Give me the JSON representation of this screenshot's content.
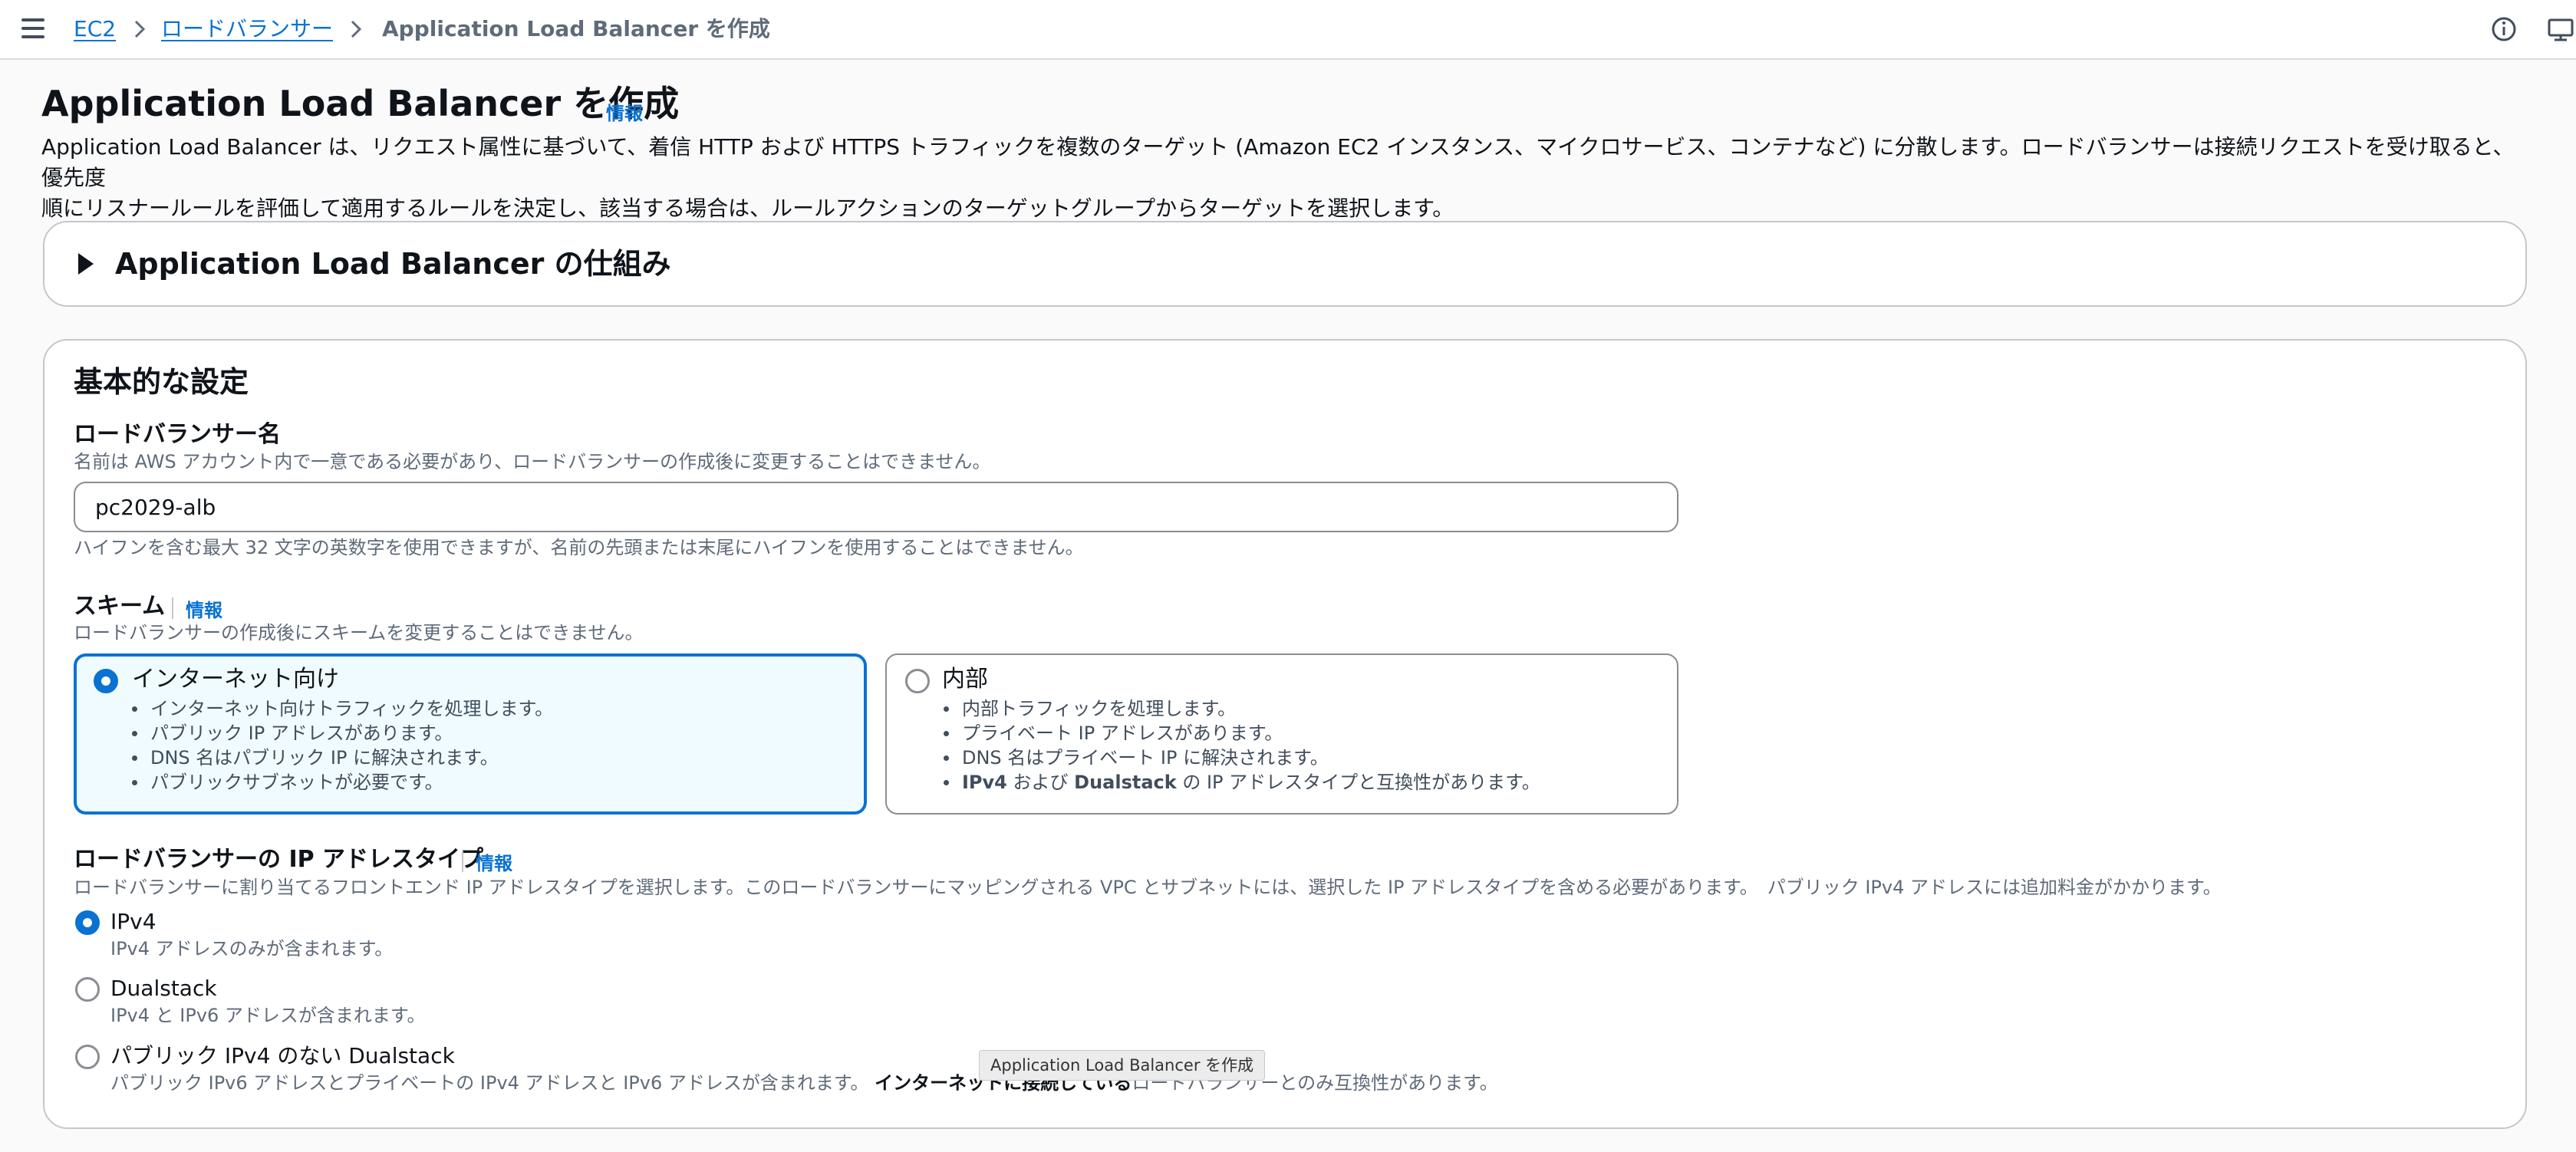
{
  "breadcrumb": {
    "items": [
      "EC2",
      "ロードバランサー"
    ],
    "current": "Application Load Balancer を作成"
  },
  "icons": {
    "menu": "hamburger-menu-icon",
    "separator": "chevron-right-icon",
    "info": "info-circle-icon",
    "feedback": "screen-feedback-icon",
    "expand": "caret-right-icon"
  },
  "header": {
    "title": "Application Load Balancer を作成",
    "info_label": "情報",
    "description_line1": "Application Load Balancer は、リクエスト属性に基づいて、着信 HTTP および HTTPS トラフィックを複数のターゲット (Amazon EC2 インスタンス、マイクロサービス、コンテナなど) に分散します。ロードバランサーは接続リクエストを受け取ると、優先度",
    "description_line2": "順にリスナールールを評価して適用するルールを決定し、該当する場合は、ルールアクションのターゲットグループからターゲットを選択します。"
  },
  "expander": {
    "title": "Application Load Balancer の仕組み",
    "expanded": false
  },
  "basic_config": {
    "title": "基本的な設定",
    "name": {
      "label": "ロードバランサー名",
      "description": "名前は AWS アカウント内で一意である必要があり、ロードバランサーの作成後に変更することはできません。",
      "value": "pc2029-alb",
      "constraint": "ハイフンを含む最大 32 文字の英数字を使用できますが、名前の先頭または末尾にハイフンを使用することはできません。"
    },
    "scheme": {
      "label": "スキーム",
      "info_label": "情報",
      "description": "ロードバランサーの作成後にスキームを変更することはできません。",
      "options": [
        {
          "title": "インターネット向け",
          "selected": true,
          "bullets": [
            "インターネット向けトラフィックを処理します。",
            "パブリック IP アドレスがあります。",
            "DNS 名はパブリック IP に解決されます。",
            "パブリックサブネットが必要です。"
          ]
        },
        {
          "title": "内部",
          "selected": false,
          "bullets": [
            "内部トラフィックを処理します。",
            "プライベート IP アドレスがあります。",
            "DNS 名はプライベート IP に解決されます。"
          ],
          "last_bullet": {
            "b1": "IPv4",
            "t1": " および ",
            "b2": "Dualstack",
            "t2": " の IP アドレスタイプと互換性があります。"
          }
        }
      ]
    },
    "ip_type": {
      "label": "ロードバランサーの IP アドレスタイプ",
      "info_label": "情報",
      "description": "ロードバランサーに割り当てるフロントエンド IP アドレスタイプを選択します。このロードバランサーにマッピングされる VPC とサブネットには、選択した IP アドレスタイプを含める必要があります。　パブリック IPv4 アドレスには追加料金がかかります。",
      "options": [
        {
          "label": "IPv4",
          "description": "IPv4 アドレスのみが含まれます。",
          "selected": true
        },
        {
          "label": "Dualstack",
          "description": "IPv4 と IPv6 アドレスが含まれます。",
          "selected": false
        },
        {
          "label": "パブリック IPv4 のない Dualstack",
          "selected": false,
          "description_part1": "パブリック IPv6 アドレスとプライベートの IPv4 アドレスと IPv6 アドレスが含まれます。 ",
          "description_bold": "インターネットに接続している",
          "description_part2": "ロードバランサーとのみ互換性があります。"
        }
      ]
    }
  },
  "tooltip": "Application Load Balancer を作成",
  "colors": {
    "link": "#0972d3",
    "selected_border": "#0972d3",
    "selected_bg": "#f0fbff",
    "text": "#0f141a",
    "muted": "#5f6b7a"
  }
}
